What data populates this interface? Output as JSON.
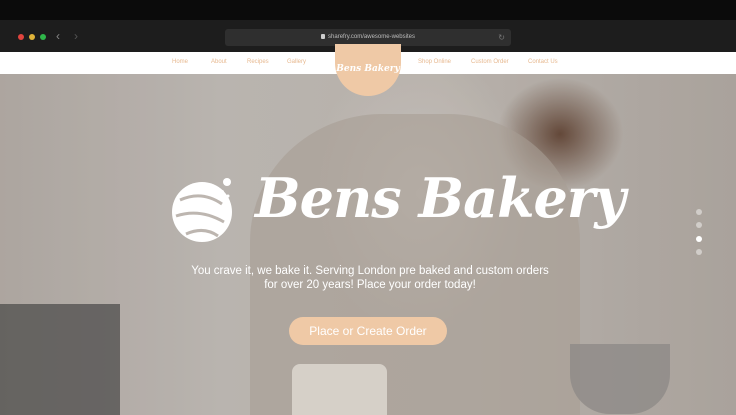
{
  "browser": {
    "url": "sharefry.com/awesome-websites",
    "traffic_lights": [
      "#e0443e",
      "#dfb339",
      "#2fb64a"
    ]
  },
  "nav": {
    "left": [
      "Home",
      "About",
      "Recipes",
      "Gallery"
    ],
    "right": [
      "Shop Online",
      "Custom Order",
      "Contact Us"
    ],
    "logo": "Bens Bakery"
  },
  "hero": {
    "title": "Bens Bakery",
    "subtitle_line1": "You crave it, we bake it. Serving London pre baked and custom orders",
    "subtitle_line2": "for over 20 years! Place your order today!",
    "cta": "Place or Create Order",
    "slides": 4,
    "active_slide": 3
  },
  "colors": {
    "accent": "#efc9a6",
    "nav_text": "#e7b990"
  }
}
